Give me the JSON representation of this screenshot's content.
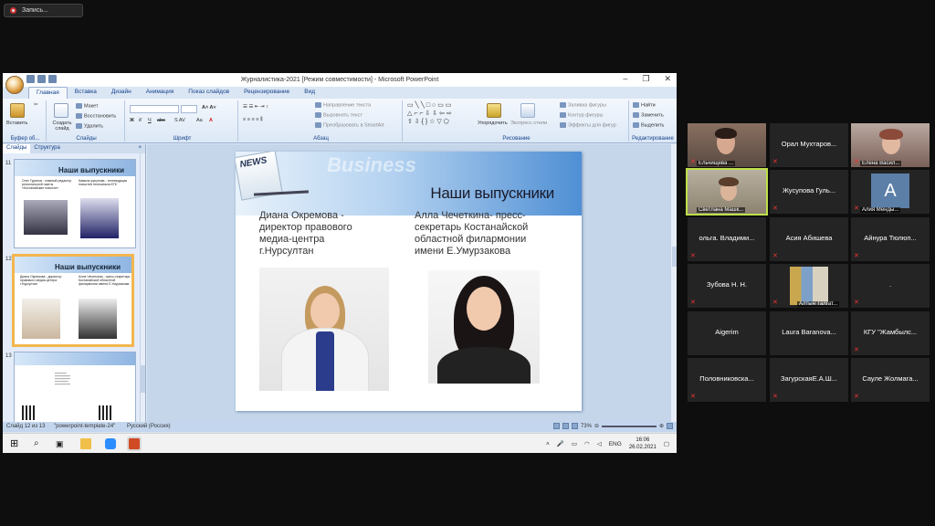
{
  "recording": {
    "label": "Запись..."
  },
  "ppt": {
    "title": "Журналистика-2021 [Режим совместимости] - Microsoft PowerPoint",
    "window_buttons": [
      "–",
      "❐",
      "✕"
    ],
    "tabs": [
      "Главная",
      "Вставка",
      "Дизайн",
      "Анимация",
      "Показ слайдов",
      "Рецензирование",
      "Вид"
    ],
    "ribbon": {
      "clipboard": {
        "paste": "Вставить",
        "group": "Буфер об...",
        "cut": "✂"
      },
      "slides": {
        "create": "Создать слайд",
        "layout": "Макет",
        "reset": "Восстановить",
        "delete": "Удалить",
        "group": "Слайды"
      },
      "font": {
        "group": "Шрифт"
      },
      "paragraph": {
        "dir": "Направление текста",
        "align": "Выровнять текст",
        "smartart": "Преобразовать в SmartArt",
        "group": "Абзац"
      },
      "drawing": {
        "arrange": "Упорядочить",
        "styles": "Экспресс-стили",
        "fill": "Заливка фигуры",
        "outline": "Контур фигуры",
        "effects": "Эффекты для фигур",
        "group": "Рисование"
      },
      "editing": {
        "find": "Найти",
        "replace": "Заменить",
        "select": "Выделить",
        "group": "Редактирование"
      }
    },
    "panel_tabs": [
      "Слайды",
      "Структура"
    ],
    "thumbs": [
      {
        "num": "11",
        "title": "Наши выпускники",
        "t1": "Олег Гуринов - главный редактор региональной газеты «Костанайские новости»",
        "t2": "Камила жусупова - телеведущая новостей телеканала КТК"
      },
      {
        "num": "12",
        "title": "Наши выпускники",
        "t1": "Диана Окремова - директор правового медиа-центра г.Нурсултан",
        "t2": "Алла Чеченкина - пресс-секретарь Костанайской областной филармонии имени Е.Умурзакова"
      },
      {
        "num": "13",
        "title": "",
        "t1": "",
        "t2": ""
      }
    ],
    "slide": {
      "banner": "Business",
      "news": "NEWS",
      "title": "Наши выпускники",
      "left_text": [
        "Диана Окремова -",
        "директор правового",
        "медиа-центра",
        "г.Нурсултан"
      ],
      "right_text": [
        "Алла Чечеткина- пресс-",
        "секретарь Костанайской",
        "областной филармонии",
        "имени Е.Умурзакова"
      ]
    },
    "status": {
      "slide": "Слайд 12 из 13",
      "theme": "\"powerpoint-template-24\"",
      "lang": "Русский (Россия)",
      "zoom": "73%"
    },
    "taskbar": {
      "lang": "ENG",
      "time": "16:06",
      "date": "26.02.2021"
    }
  },
  "participants": [
    {
      "name": "Ельчищева ...",
      "video": true
    },
    {
      "name": "Орал Мухтаров...",
      "video": false
    },
    {
      "name": "Елена Васил...",
      "video": true
    },
    {
      "name": "Светлана Машк...",
      "video": true,
      "speaking": true
    },
    {
      "name": "Жусупова Гуль...",
      "video": false
    },
    {
      "name": "Алия Менды...",
      "video": false,
      "avatar": "A"
    },
    {
      "name": "ольга. Владими...",
      "video": false
    },
    {
      "name": "Асия Абишева",
      "video": false
    },
    {
      "name": "Айнура Тюлюп...",
      "video": false
    },
    {
      "name": "Зубова Н. Н.",
      "video": false
    },
    {
      "name": "Алтын Талгат...",
      "video": true
    },
    {
      "name": ".",
      "video": false
    },
    {
      "name": "Aigerim",
      "video": false
    },
    {
      "name": "Laura Baranova...",
      "video": false
    },
    {
      "name": "КГУ \"Жамбылс...",
      "video": false
    },
    {
      "name": "Половниковска...",
      "video": false
    },
    {
      "name": "ЗагурскаяЕ.А.Ш...",
      "video": false
    },
    {
      "name": "Сауле Жолмага...",
      "video": false
    }
  ],
  "colors": {
    "speaking": "#bde04a",
    "muted": "#e33",
    "ppt_blue": "#15428b"
  }
}
